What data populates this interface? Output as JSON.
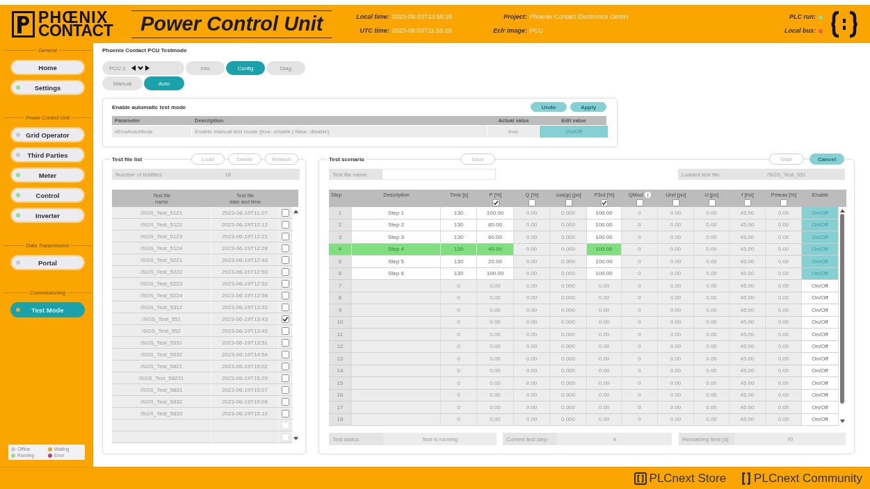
{
  "header": {
    "logo": {
      "line_1": "PHŒNIX",
      "line_2": "CONTACT"
    },
    "title": "Power Control Unit",
    "local_time": {
      "label": "Local time:",
      "value": "2023-08-03T13:55:26"
    },
    "utc_time": {
      "label": "UTC time:",
      "value": "2023-08-03T11:55:26"
    },
    "project": {
      "label": "Project:",
      "value": "Phoenix Contact Electronics GmbH"
    },
    "eclr_image": {
      "label": "Eclr image:",
      "value": "PCU"
    },
    "plc_run": {
      "label": "PLC run:",
      "color": "#8fdf8f"
    },
    "local_bus": {
      "label": "Local bus:",
      "color": "#e85a5a"
    }
  },
  "sidebar": {
    "groups": [
      {
        "title": "General",
        "items": [
          {
            "label": "Home",
            "selected": false
          },
          {
            "label": "Settings",
            "color": "#8fdf8f",
            "selected": false
          }
        ]
      },
      {
        "title": "Power Control Unit",
        "items": [
          {
            "label": "Grid Operator",
            "color": "#c8cad6",
            "selected": false
          },
          {
            "label": "Third Parties",
            "color": "#c8cad6",
            "selected": false
          },
          {
            "label": "Meter",
            "color": "#8fdf8f",
            "selected": false
          },
          {
            "label": "Control",
            "color": "#8fdf8f",
            "selected": false
          },
          {
            "label": "Inverter",
            "color": "#8fdf8f",
            "selected": false
          }
        ]
      },
      {
        "title": "Data Transmission",
        "items": [
          {
            "label": "Portal",
            "color": "#c8cad6",
            "selected": false
          }
        ]
      },
      {
        "title": "Commissioning",
        "items": [
          {
            "label": "Test Mode",
            "color": "#e2ac34",
            "selected": true
          }
        ]
      }
    ],
    "legend": [
      {
        "label": "Offline",
        "color": "#c8cad6"
      },
      {
        "label": "Waiting",
        "color": "#e2ac34"
      },
      {
        "label": "Running",
        "color": "#8fdf8f"
      },
      {
        "label": "Error",
        "color": "#b2486a"
      }
    ]
  },
  "page": {
    "title": "Phoenix Contact PCU Testmode",
    "device": "PCU 1",
    "tabs": [
      {
        "label": "Info",
        "selected": false
      },
      {
        "label": "Config",
        "selected": true
      },
      {
        "label": "Diag",
        "selected": false
      }
    ],
    "modes": [
      {
        "label": "Manual",
        "selected": false
      },
      {
        "label": "Auto",
        "selected": true
      }
    ]
  },
  "auto_mode": {
    "title": "Enable automatic test mode",
    "buttons": [
      {
        "label": "Undo",
        "disabled": false
      },
      {
        "label": "Apply",
        "disabled": false
      }
    ],
    "columns": [
      "Parameter",
      "Description",
      "Actual value",
      "Edit value"
    ],
    "rows": [
      {
        "parameter": "xEnaAutoMode",
        "description": "Enable manual test mode (true: enable | false: disable)",
        "actual_value": "true",
        "edit_value": "On/Off"
      }
    ]
  },
  "file_list": {
    "title": "Test file list",
    "buttons": [
      {
        "label": "Load",
        "disabled": true
      },
      {
        "label": "Delete",
        "disabled": true
      },
      {
        "label": "Refresh",
        "disabled": true
      }
    ],
    "count": {
      "label": "Number of testfiles",
      "value": "18"
    },
    "columns": [
      "Test file\nname",
      "Test file\ndate and time"
    ],
    "rows": [
      {
        "name": "/SGS_Test_5121",
        "date": "2023-06-19T11:27",
        "checked": false,
        "disabled": false
      },
      {
        "name": "/SGS_Test_5122",
        "date": "2023-06-19T12:12",
        "checked": false,
        "disabled": false
      },
      {
        "name": "/SGS_Test_5123",
        "date": "2023-06-19T12:21",
        "checked": false,
        "disabled": false
      },
      {
        "name": "/SGS_Test_5124",
        "date": "2023-06-19T12:28",
        "checked": false,
        "disabled": false
      },
      {
        "name": "/SGS_Test_5221",
        "date": "2023-06-19T12:43",
        "checked": false,
        "disabled": false
      },
      {
        "name": "/SGS_Test_5222",
        "date": "2023-06-19T12:50",
        "checked": false,
        "disabled": false
      },
      {
        "name": "/SGS_Test_5223",
        "date": "2023-06-19T12:52",
        "checked": false,
        "disabled": false
      },
      {
        "name": "/SGS_Test_5224",
        "date": "2023-06-19T12:58",
        "checked": false,
        "disabled": false
      },
      {
        "name": "/SGS_Test_5312",
        "date": "2023-06-19T13:32",
        "checked": false,
        "disabled": false
      },
      {
        "name": "/SGS_Test_551",
        "date": "2023-06-19T13:43",
        "checked": true,
        "disabled": false
      },
      {
        "name": "/SGS_Test_552",
        "date": "2023-06-19T13:45",
        "checked": false,
        "disabled": false
      },
      {
        "name": "/SGS_Test_5531",
        "date": "2023-06-19T13:51",
        "checked": false,
        "disabled": false
      },
      {
        "name": "/SGS_Test_5532",
        "date": "2023-06-19T14:54",
        "checked": false,
        "disabled": false
      },
      {
        "name": "/SGS_Test_5821",
        "date": "2023-06-19T15:02",
        "checked": false,
        "disabled": false
      },
      {
        "name": "/SGS_Test_58231",
        "date": "2023-06-19T15:29",
        "checked": false,
        "disabled": false
      },
      {
        "name": "/SGS_Test_5831",
        "date": "2023-06-19T15:07",
        "checked": false,
        "disabled": false
      },
      {
        "name": "/SGS_Test_5832",
        "date": "2023-06-19T15:09",
        "checked": false,
        "disabled": false
      },
      {
        "name": "/SGS_Test_5833",
        "date": "2023-06-19T15:10",
        "checked": false,
        "disabled": false
      },
      {
        "checked": false,
        "disabled": true
      },
      {
        "checked": false,
        "disabled": true
      }
    ]
  },
  "scenario": {
    "title": "Test scenario",
    "save": {
      "label": "Save",
      "disabled": true
    },
    "start": {
      "label": "Start",
      "disabled": true
    },
    "cancel": {
      "label": "Cancel",
      "disabled": false
    },
    "file_name": {
      "label": "Test file name"
    },
    "loaded_file": {
      "label": "Loaded test file",
      "value": "/SGS_Test_551"
    },
    "columns": [
      {
        "label": "Step",
        "kind": "index"
      },
      {
        "label": "Description",
        "kind": "text"
      },
      {
        "label": "Time [s]",
        "kind": "text"
      },
      {
        "label": "P [%]",
        "kind": "toggle",
        "checked": true
      },
      {
        "label": "Q [%]",
        "kind": "toggle",
        "checked": false
      },
      {
        "label": "cos(φ) [pu]",
        "kind": "toggle",
        "checked": false
      },
      {
        "label": "P3rd [%]",
        "kind": "toggle",
        "checked": true
      },
      {
        "label": "QMod",
        "kind": "toggle",
        "checked": false,
        "info": true
      },
      {
        "label": "Uref [pu]",
        "kind": "toggle",
        "checked": false
      },
      {
        "label": "U [pu]",
        "kind": "toggle",
        "checked": false
      },
      {
        "label": "f [Hz]",
        "kind": "toggle",
        "checked": false
      },
      {
        "label": "Pmeas [%]",
        "kind": "toggle",
        "checked": false
      },
      {
        "label": "Enable",
        "kind": "enable"
      }
    ],
    "rows": [
      {
        "cells": [
          "1",
          "Step 1",
          "130",
          "100.00",
          "0.00",
          "0.000",
          "100.00",
          "0",
          "0.00",
          "0.00",
          "45.00",
          "0.00",
          "On/Off"
        ],
        "enabled": true,
        "current": false
      },
      {
        "cells": [
          "2",
          "Step 2",
          "130",
          "80.00",
          "0.00",
          "0.000",
          "100.00",
          "0",
          "0.00",
          "0.00",
          "45.00",
          "0.00",
          "On/Off"
        ],
        "enabled": true,
        "current": false
      },
      {
        "cells": [
          "3",
          "Step 3",
          "130",
          "60.00",
          "0.00",
          "0.000",
          "100.00",
          "0",
          "0.00",
          "0.00",
          "45.00",
          "0.00",
          "On/Off"
        ],
        "enabled": true,
        "current": false
      },
      {
        "cells": [
          "4",
          "Step 4",
          "130",
          "40.00",
          "0.00",
          "0.000",
          "100.00",
          "0",
          "0.00",
          "0.00",
          "45.00",
          "0.00",
          "On/Off"
        ],
        "enabled": true,
        "current": true
      },
      {
        "cells": [
          "5",
          "Step 5",
          "130",
          "20.00",
          "0.00",
          "0.000",
          "100.00",
          "0",
          "0.00",
          "0.00",
          "45.00",
          "0.00",
          "On/Off"
        ],
        "enabled": true,
        "current": false
      },
      {
        "cells": [
          "6",
          "Step 6",
          "130",
          "100.00",
          "0.00",
          "0.000",
          "100.00",
          "0",
          "0.00",
          "0.00",
          "45.00",
          "0.00",
          "On/Off"
        ],
        "enabled": true,
        "current": false
      },
      {
        "cells": [
          "7",
          null,
          "0",
          "0.00",
          "0.00",
          "0.000",
          "0.00",
          "0",
          "0.00",
          "0.00",
          "45.00",
          "0.00",
          "On/Off"
        ],
        "enabled": false,
        "current": false
      },
      {
        "cells": [
          "8",
          null,
          "0",
          "0.00",
          "0.00",
          "0.000",
          "0.00",
          "0",
          "0.00",
          "0.00",
          "45.00",
          "0.00",
          "On/Off"
        ],
        "enabled": false,
        "current": false
      },
      {
        "cells": [
          "9",
          null,
          "0",
          "0.00",
          "0.00",
          "0.000",
          "0.00",
          "0",
          "0.00",
          "0.00",
          "45.00",
          "0.00",
          "On/Off"
        ],
        "enabled": false,
        "current": false
      },
      {
        "cells": [
          "10",
          null,
          "0",
          "0.00",
          "0.00",
          "0.000",
          "0.00",
          "0",
          "0.00",
          "0.00",
          "45.00",
          "0.00",
          "On/Off"
        ],
        "enabled": false,
        "current": false
      },
      {
        "cells": [
          "11",
          null,
          "0",
          "0.00",
          "0.00",
          "0.000",
          "0.00",
          "0",
          "0.00",
          "0.00",
          "45.00",
          "0.00",
          "On/Off"
        ],
        "enabled": false,
        "current": false
      },
      {
        "cells": [
          "12",
          null,
          "0",
          "0.00",
          "0.00",
          "0.000",
          "0.00",
          "0",
          "0.00",
          "0.00",
          "45.00",
          "0.00",
          "On/Off"
        ],
        "enabled": false,
        "current": false
      },
      {
        "cells": [
          "13",
          null,
          "0",
          "0.00",
          "0.00",
          "0.000",
          "0.00",
          "0",
          "0.00",
          "0.00",
          "45.00",
          "0.00",
          "On/Off"
        ],
        "enabled": false,
        "current": false
      },
      {
        "cells": [
          "14",
          null,
          "0",
          "0.00",
          "0.00",
          "0.000",
          "0.00",
          "0",
          "0.00",
          "0.00",
          "45.00",
          "0.00",
          "On/Off"
        ],
        "enabled": false,
        "current": false
      },
      {
        "cells": [
          "15",
          null,
          "0",
          "0.00",
          "0.00",
          "0.000",
          "0.00",
          "0",
          "0.00",
          "0.00",
          "45.00",
          "0.00",
          "On/Off"
        ],
        "enabled": false,
        "current": false
      },
      {
        "cells": [
          "16",
          null,
          "0",
          "0.00",
          "0.00",
          "0.000",
          "0.00",
          "0",
          "0.00",
          "0.00",
          "45.00",
          "0.00",
          "On/Off"
        ],
        "enabled": false,
        "current": false
      },
      {
        "cells": [
          "17",
          null,
          "0",
          "0.00",
          "0.00",
          "0.000",
          "0.00",
          "0",
          "0.00",
          "0.00",
          "45.00",
          "0.00",
          "On/Off"
        ],
        "enabled": false,
        "current": false
      },
      {
        "cells": [
          "18",
          null,
          "0",
          "0.00",
          "0.00",
          "0.000",
          "0.00",
          "0",
          "0.00",
          "0.00",
          "45.00",
          "0.00",
          "On/Off"
        ],
        "enabled": false,
        "current": false
      }
    ],
    "status": [
      {
        "label": "Test status",
        "value": "Test is running"
      },
      {
        "label": "Current test step",
        "value": "4"
      },
      {
        "label": "Remaining time [s]",
        "value": "70"
      }
    ]
  },
  "footer": {
    "links": [
      {
        "label": "PLCnext Store",
        "kind": "store"
      },
      {
        "label": "PLCnext Community",
        "kind": "community"
      }
    ]
  }
}
